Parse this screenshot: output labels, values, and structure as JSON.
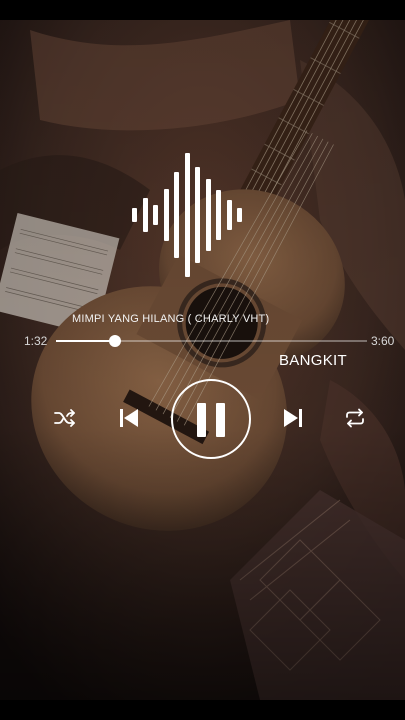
{
  "player": {
    "song_title": "MIMPI YANG HILANG ( CHARLY VHT)",
    "artist": "BANGKIT",
    "elapsed": "1:32",
    "total": "3:60",
    "progress_fraction": 0.19
  },
  "controls": {
    "shuffle": "shuffle-icon",
    "previous": "skip-previous-icon",
    "play_pause": "pause-icon",
    "next": "skip-next-icon",
    "repeat": "repeat-icon"
  },
  "colors": {
    "text": "#ffffff",
    "track": "#ffffff"
  }
}
